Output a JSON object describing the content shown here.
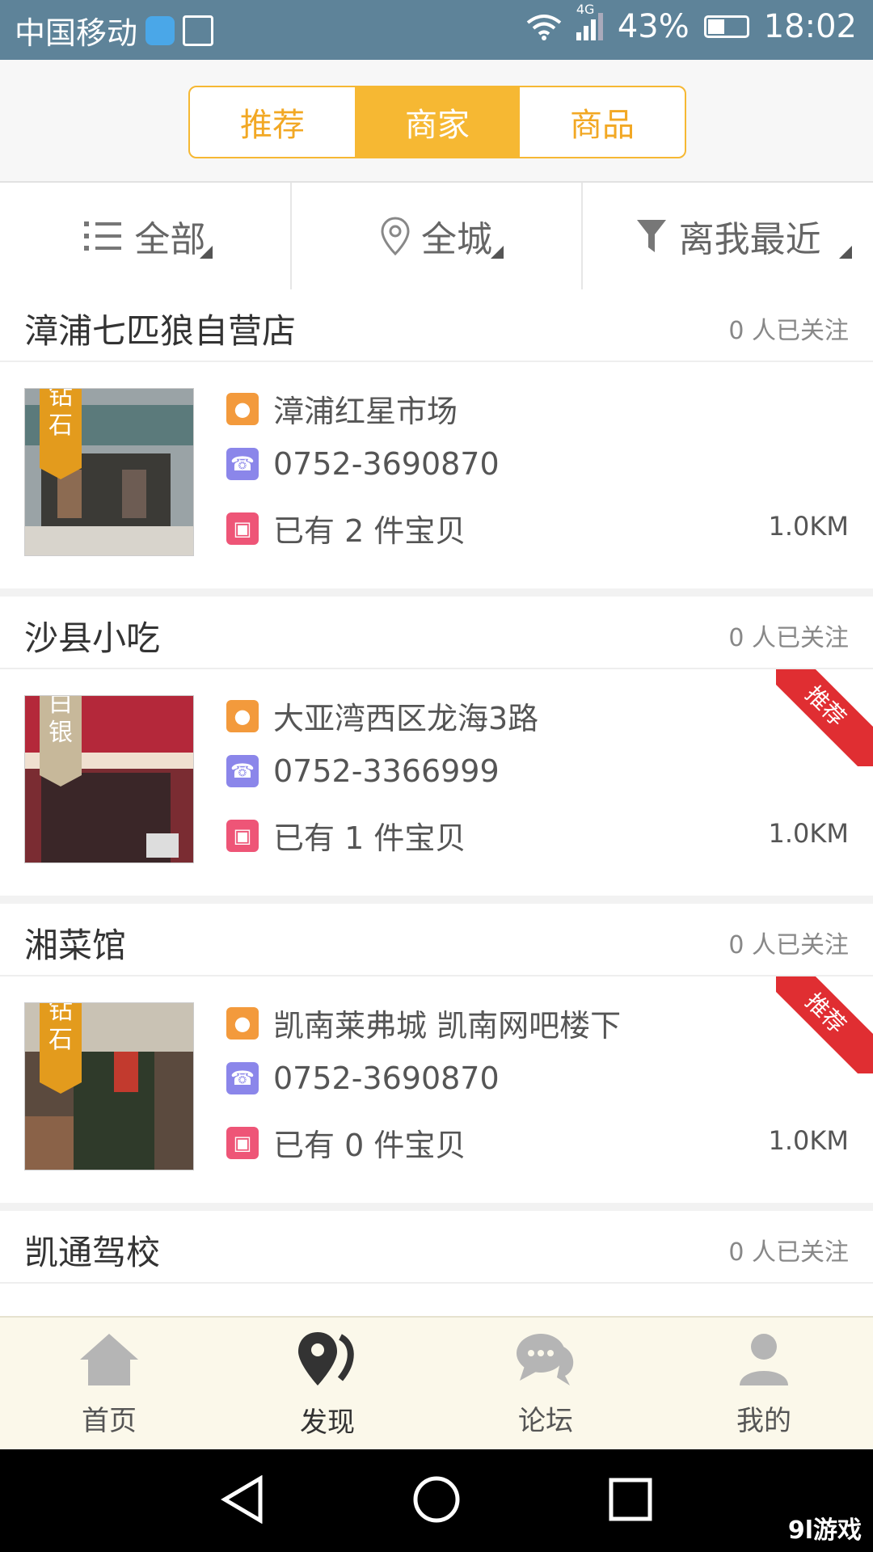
{
  "statusbar": {
    "carrier": "中国移动",
    "network": "4G",
    "battery": "43%",
    "time": "18:02"
  },
  "segments": [
    {
      "label": "推荐",
      "active": false
    },
    {
      "label": "商家",
      "active": true
    },
    {
      "label": "商品",
      "active": false
    }
  ],
  "filters": [
    {
      "label": "全部",
      "icon": "list-icon"
    },
    {
      "label": "全城",
      "icon": "location-pin-icon"
    },
    {
      "label": "离我最近",
      "icon": "filter-icon"
    }
  ],
  "shops": [
    {
      "name": "漳浦七匹狼自营店",
      "followers": "0 人已关注",
      "rank": "钻石",
      "address": "漳浦红星市场",
      "phone": "0752-3690870",
      "items": "已有 2 件宝贝",
      "distance": "1.0KM",
      "recommended": false
    },
    {
      "name": "沙县小吃",
      "followers": "0 人已关注",
      "rank": "白银",
      "address": "大亚湾西区龙海3路",
      "phone": "0752-3366999",
      "items": "已有 1 件宝贝",
      "distance": "1.0KM",
      "recommended": true,
      "ribbon": "推荐"
    },
    {
      "name": "湘菜馆",
      "followers": "0 人已关注",
      "rank": "钻石",
      "address": "凯南莱弗城 凯南网吧楼下",
      "phone": "0752-3690870",
      "items": "已有 0 件宝贝",
      "distance": "1.0KM",
      "recommended": true,
      "ribbon": "推荐"
    },
    {
      "name": "凯通驾校",
      "followers": "0 人已关注"
    }
  ],
  "tabs": [
    {
      "label": "首页",
      "icon": "home-icon"
    },
    {
      "label": "发现",
      "icon": "discover-icon"
    },
    {
      "label": "论坛",
      "icon": "forum-icon"
    },
    {
      "label": "我的",
      "icon": "profile-icon"
    }
  ],
  "colors": {
    "accent": "#f6b833",
    "statusbar": "#5e8399",
    "ribbon": "#e02e32"
  },
  "watermark": "9l游戏"
}
